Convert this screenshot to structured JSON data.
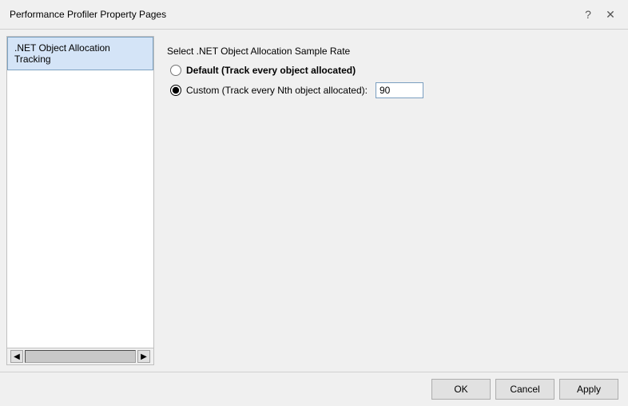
{
  "titleBar": {
    "title": "Performance Profiler Property Pages",
    "helpBtn": "?",
    "closeBtn": "✕"
  },
  "sidebar": {
    "items": [
      {
        "label": ".NET Object Allocation Tracking"
      }
    ],
    "scrollLeftLabel": "◀",
    "scrollRightLabel": "▶"
  },
  "rightPanel": {
    "sectionTitle": "Select .NET Object Allocation Sample Rate",
    "radios": [
      {
        "id": "radio-default",
        "label": "Default (Track every object allocated)",
        "checked": false,
        "bold": true
      },
      {
        "id": "radio-custom",
        "label": "Custom (Track every Nth object allocated):",
        "checked": true,
        "bold": false
      }
    ],
    "customValue": "90"
  },
  "bottomBar": {
    "okLabel": "OK",
    "cancelLabel": "Cancel",
    "applyLabel": "Apply"
  }
}
